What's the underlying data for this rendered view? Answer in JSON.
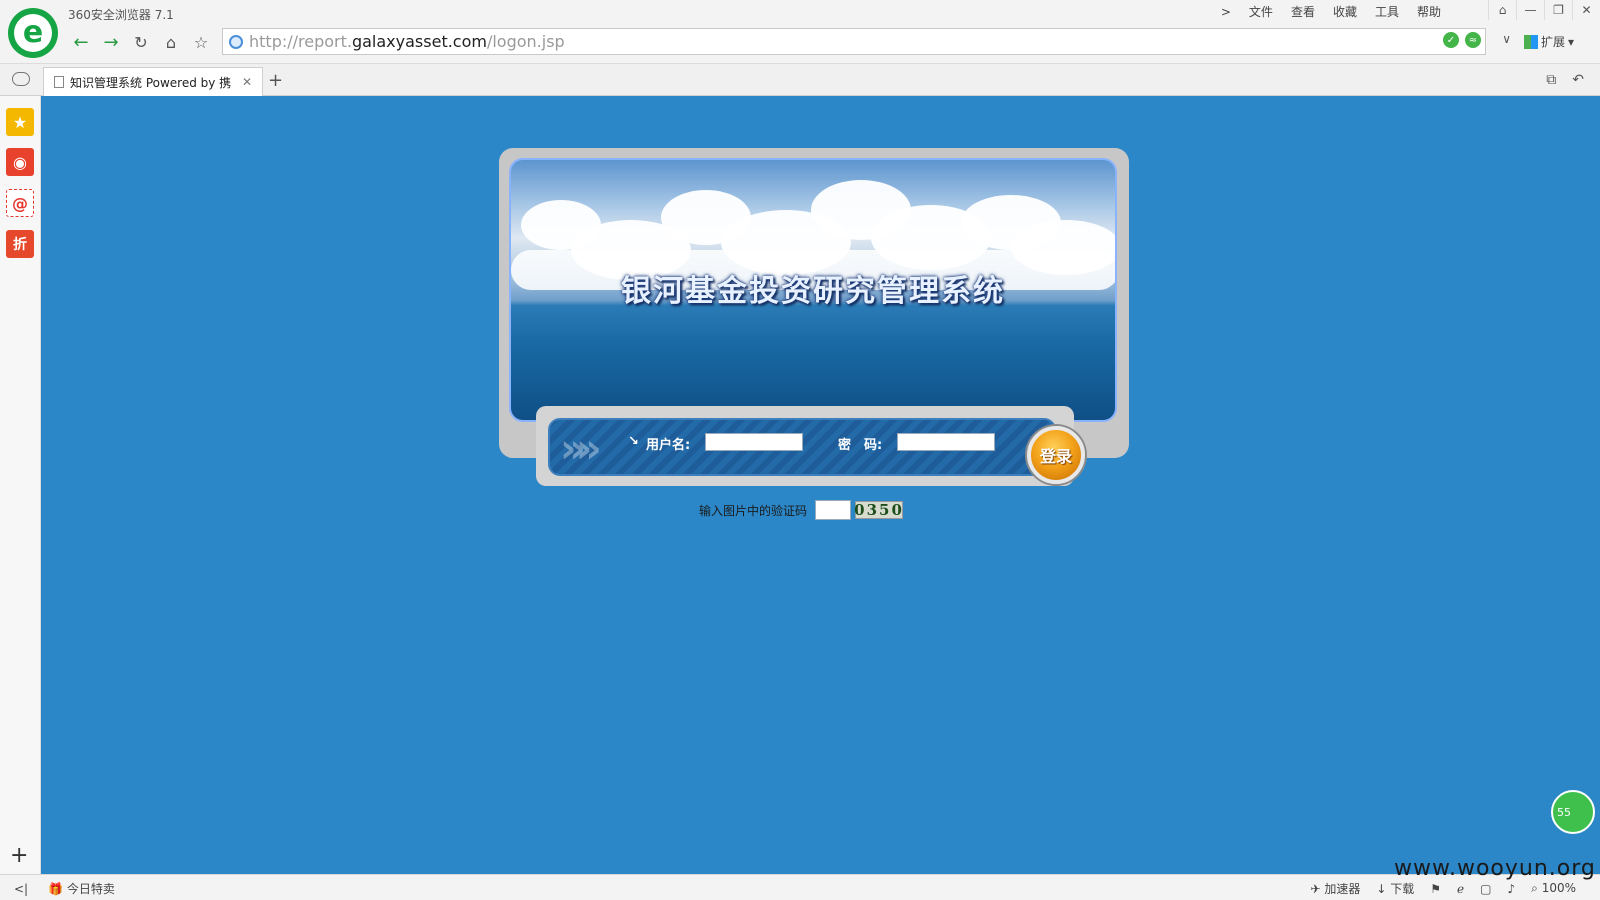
{
  "browser": {
    "app_title": "360安全浏览器 7.1",
    "logo_letter": "e",
    "menu": [
      "文件",
      "查看",
      "收藏",
      "工具",
      "帮助"
    ],
    "menu_arrow": ">",
    "window_buttons": [
      "⌂",
      "—",
      "❐",
      "✕"
    ],
    "address": {
      "prefix": "http://report.",
      "domain": "galaxyasset.com",
      "path": "/logon.jsp"
    },
    "extend_label": "扩展",
    "tab": {
      "title": "知识管理系统 Powered by 携",
      "close": "✕"
    },
    "new_tab": "+"
  },
  "sidebar": {
    "icons": [
      {
        "name": "star-icon",
        "glyph": "★",
        "color": "#f5b800"
      },
      {
        "name": "weibo-icon",
        "glyph": "◉",
        "color": "#e8412c"
      },
      {
        "name": "mail-icon",
        "glyph": "@",
        "color": "#e5372e"
      },
      {
        "name": "discount-icon",
        "glyph": "折",
        "color": "#e5482b"
      }
    ],
    "add": "+"
  },
  "login": {
    "system_title": "银河基金投资研究管理系统",
    "username_label": "用户名:",
    "password_label": "密　码:",
    "login_button": "登录",
    "captcha_label": "输入图片中的验证码",
    "captcha_code": "0350"
  },
  "floating_badge": "55",
  "statusbar": {
    "collapse": "<|",
    "today_deals": "今日特卖",
    "accelerator": "加速器",
    "download": "下载",
    "zoom": "100%"
  },
  "watermark": "www.wooyun.org"
}
